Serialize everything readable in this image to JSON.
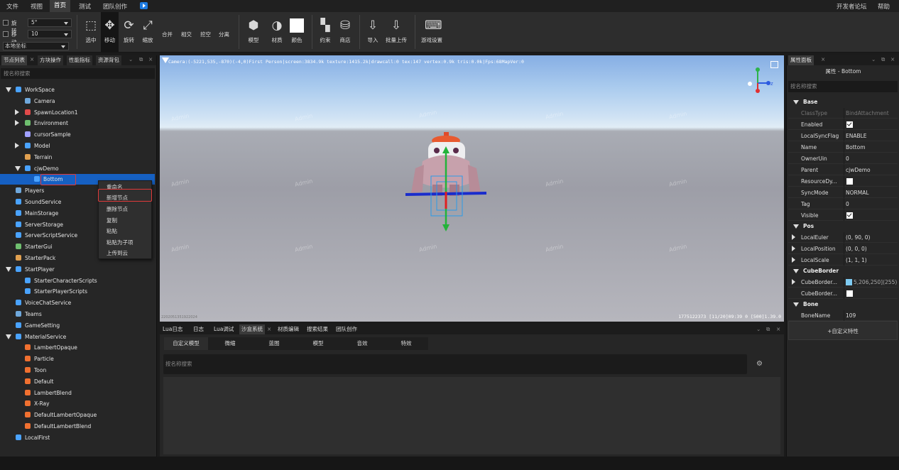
{
  "menu": {
    "file": "文件",
    "view": "视图",
    "home": "首页",
    "test": "测试",
    "team": "团队创作",
    "forum": "开发者论坛",
    "help": "帮助"
  },
  "toolbar": {
    "rotate_label": "旋转",
    "rotate_value": "5°",
    "move_label": "移动",
    "move_value": "10",
    "coord_value": "本地坐标",
    "select": "选中",
    "move": "移动",
    "rotate": "旋转",
    "scale": "缩放",
    "merge": "合并",
    "intersect": "相交",
    "hollow": "挖空",
    "separate": "分离",
    "model": "模型",
    "material": "材质",
    "color": "颜色",
    "constraint": "约束",
    "shop": "商店",
    "import": "导入",
    "batch_upload": "批量上传",
    "game_settings": "游戏设置"
  },
  "left_panel": {
    "tabs": [
      "节点列表",
      "方块操作",
      "性能指标",
      "资源背包"
    ],
    "search_placeholder": "按名称搜索",
    "tree": [
      {
        "label": "WorkSpace",
        "indent": 0,
        "arrow": "open",
        "color": "#4aa3ff"
      },
      {
        "label": "Camera",
        "indent": 1,
        "arrow": "",
        "color": "#6fa8dc"
      },
      {
        "label": "SpawnLocation1",
        "indent": 1,
        "arrow": "closed",
        "color": "#e04a4a"
      },
      {
        "label": "Environment",
        "indent": 1,
        "arrow": "closed",
        "color": "#6fbf6f"
      },
      {
        "label": "cursorSample",
        "indent": 1,
        "arrow": "",
        "color": "#a0a0ff"
      },
      {
        "label": "Model",
        "indent": 1,
        "arrow": "closed",
        "color": "#4aa3ff"
      },
      {
        "label": "Terrain",
        "indent": 1,
        "arrow": "",
        "color": "#e0a050"
      },
      {
        "label": "cjwDemo",
        "indent": 1,
        "arrow": "open",
        "color": "#4aa3ff"
      },
      {
        "label": "Bottom",
        "indent": 2,
        "arrow": "",
        "color": "#4aa3ff",
        "selected": true
      },
      {
        "label": "Players",
        "indent": 0,
        "arrow": "",
        "color": "#6fa8dc"
      },
      {
        "label": "SoundService",
        "indent": 0,
        "arrow": "",
        "color": "#4aa3ff"
      },
      {
        "label": "MainStorage",
        "indent": 0,
        "arrow": "",
        "color": "#4aa3ff"
      },
      {
        "label": "ServerStorage",
        "indent": 0,
        "arrow": "",
        "color": "#4aa3ff"
      },
      {
        "label": "ServerScriptService",
        "indent": 0,
        "arrow": "",
        "color": "#4aa3ff"
      },
      {
        "label": "StarterGui",
        "indent": 0,
        "arrow": "",
        "color": "#6fbf6f"
      },
      {
        "label": "StarterPack",
        "indent": 0,
        "arrow": "",
        "color": "#e0a050"
      },
      {
        "label": "StartPlayer",
        "indent": 0,
        "arrow": "open",
        "color": "#4aa3ff"
      },
      {
        "label": "StarterCharacterScripts",
        "indent": 1,
        "arrow": "",
        "color": "#4aa3ff"
      },
      {
        "label": "StarterPlayerScripts",
        "indent": 1,
        "arrow": "",
        "color": "#4aa3ff"
      },
      {
        "label": "VoiceChatService",
        "indent": 0,
        "arrow": "",
        "color": "#4aa3ff"
      },
      {
        "label": "Teams",
        "indent": 0,
        "arrow": "",
        "color": "#6fa8dc"
      },
      {
        "label": "GameSetting",
        "indent": 0,
        "arrow": "",
        "color": "#4aa3ff"
      },
      {
        "label": "MaterialService",
        "indent": 0,
        "arrow": "open",
        "color": "#4aa3ff"
      },
      {
        "label": "LambertOpaque",
        "indent": 1,
        "arrow": "",
        "color": "#f07030"
      },
      {
        "label": "Particle",
        "indent": 1,
        "arrow": "",
        "color": "#f07030"
      },
      {
        "label": "Toon",
        "indent": 1,
        "arrow": "",
        "color": "#f07030"
      },
      {
        "label": "Default",
        "indent": 1,
        "arrow": "",
        "color": "#f07030"
      },
      {
        "label": "LambertBlend",
        "indent": 1,
        "arrow": "",
        "color": "#f07030"
      },
      {
        "label": "X-Ray",
        "indent": 1,
        "arrow": "",
        "color": "#f07030"
      },
      {
        "label": "DefaultLambertOpaque",
        "indent": 1,
        "arrow": "",
        "color": "#f07030"
      },
      {
        "label": "DefaultLambertBlend",
        "indent": 1,
        "arrow": "",
        "color": "#f07030"
      },
      {
        "label": "LocalFirst",
        "indent": 0,
        "arrow": "",
        "color": "#4aa3ff"
      }
    ]
  },
  "context_menu": {
    "items": [
      "重命名",
      "新增节点",
      "删除节点",
      "复制",
      "粘贴",
      "粘贴为子项",
      "上传到云"
    ]
  },
  "viewport": {
    "stats": "Camera:(-5221,535,-870)(-4,0)First Person|screen:3834.9k texture:1415.2k|drawcall:0 tex:147 vertex:0.9k tris:0.0k|Fps:68MapVer:0",
    "stats_bottom": "1775122373 [11/20]09:39 0 [500]1.39.0",
    "watermark": "Admin",
    "small_text": "2202051351922024"
  },
  "bottom_panel": {
    "tabs": [
      "Lua日志",
      "日志",
      "Lua调试",
      "沙盒系统",
      "材质编辑",
      "搜索结果",
      "团队创作"
    ],
    "asset_tabs": [
      "自定义模型",
      "微缩",
      "蓝图",
      "模型",
      "音效",
      "特效"
    ],
    "search_placeholder": "按名称搜索"
  },
  "right_panel": {
    "tab": "属性面板",
    "title": "属性 - Bottom",
    "search_placeholder": "按名称搜索",
    "sections": {
      "base": "Base",
      "pos": "Pos",
      "cube_border": "CubeBorder",
      "bone": "Bone"
    },
    "props": {
      "classtype_name": "ClassType",
      "classtype_value": "BindAttachment",
      "enabled_name": "Enabled",
      "localsync_name": "LocalSyncFlag",
      "localsync_value": "ENABLE",
      "name_name": "Name",
      "name_value": "Bottom",
      "owneruin_name": "OwnerUin",
      "owneruin_value": "0",
      "parent_name": "Parent",
      "parent_value": "cjwDemo",
      "resource_name": "ResourceDy...",
      "syncmode_name": "SyncMode",
      "syncmode_value": "NORMAL",
      "tag_name": "Tag",
      "tag_value": "0",
      "visible_name": "Visible",
      "localeuler_name": "LocalEuler",
      "localeuler_value": "(0, 90, 0)",
      "localposition_name": "LocalPosition",
      "localposition_value": "(0, 0, 0)",
      "localscale_name": "LocalScale",
      "localscale_value": "(1, 1, 1)",
      "cbcolor_name": "CubeBorder...",
      "cbcolor_value": "5,206,250](255)",
      "cbenable_name": "CubeBorder...",
      "bonename_name": "BoneName",
      "bonename_value": "109"
    },
    "custom_attr_button": "+自定义特性",
    "swatch_color": "#7ecbf2"
  },
  "colors": {
    "accent": "#1660c2",
    "highlight_box": "#e03a3a"
  }
}
